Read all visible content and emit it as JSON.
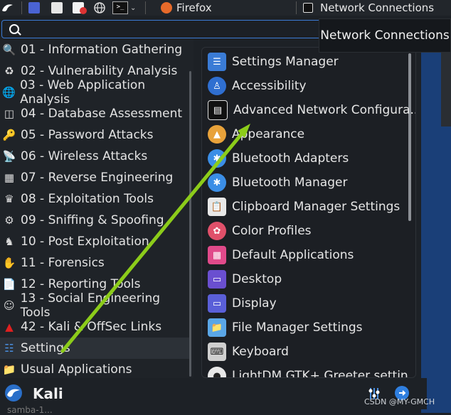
{
  "taskbar": {
    "tasks": [
      {
        "label": "Firefox",
        "icon": "firefox-icon"
      },
      {
        "label": "Network Connections",
        "icon": "network-icon"
      }
    ]
  },
  "search": {
    "placeholder": "",
    "value": ""
  },
  "tooltip": {
    "text": "Network Connections"
  },
  "categories": [
    {
      "label": "01 - Information Gathering",
      "icon": "magnifier-icon"
    },
    {
      "label": "02 - Vulnerability Analysis",
      "icon": "vulnerability-icon"
    },
    {
      "label": "03 - Web Application Analysis",
      "icon": "globe-icon"
    },
    {
      "label": "04 - Database Assessment",
      "icon": "database-icon"
    },
    {
      "label": "05 - Password Attacks",
      "icon": "key-icon"
    },
    {
      "label": "06 - Wireless Attacks",
      "icon": "wireless-icon"
    },
    {
      "label": "07 - Reverse Engineering",
      "icon": "chip-icon"
    },
    {
      "label": "08 - Exploitation Tools",
      "icon": "crown-icon"
    },
    {
      "label": "09 - Sniffing & Spoofing",
      "icon": "sniff-icon"
    },
    {
      "label": "10 - Post Exploitation",
      "icon": "post-exploit-icon"
    },
    {
      "label": "11 - Forensics",
      "icon": "hand-icon"
    },
    {
      "label": "12 - Reporting Tools",
      "icon": "report-icon"
    },
    {
      "label": "13 - Social Engineering Tools",
      "icon": "social-icon"
    },
    {
      "label": "42 - Kali & OffSec Links",
      "icon": "kali-flag-icon"
    },
    {
      "label": "Settings",
      "icon": "settings-icon"
    },
    {
      "label": "Usual Applications",
      "icon": "folder-icon"
    }
  ],
  "submenu": [
    {
      "label": "Settings Manager",
      "icon": "sliders-icon",
      "color": "#3a7bd5"
    },
    {
      "label": "Accessibility",
      "icon": "accessibility-icon",
      "color": "#2f6fd1"
    },
    {
      "label": "Advanced Network Configura...",
      "icon": "network-config-icon",
      "color": "#111111"
    },
    {
      "label": "Appearance",
      "icon": "appearance-icon",
      "color": "#e8a23a"
    },
    {
      "label": "Bluetooth Adapters",
      "icon": "bluetooth-icon",
      "color": "#3b8ee6"
    },
    {
      "label": "Bluetooth Manager",
      "icon": "bluetooth-icon",
      "color": "#3b8ee6"
    },
    {
      "label": "Clipboard Manager Settings",
      "icon": "clipboard-icon",
      "color": "#e8e8e8"
    },
    {
      "label": "Color Profiles",
      "icon": "color-profiles-icon",
      "color": "#e0506a"
    },
    {
      "label": "Default Applications",
      "icon": "default-apps-icon",
      "color": "#e04a8a"
    },
    {
      "label": "Desktop",
      "icon": "desktop-icon",
      "color": "#6a4fd0"
    },
    {
      "label": "Display",
      "icon": "display-icon",
      "color": "#5a5fd8"
    },
    {
      "label": "File Manager Settings",
      "icon": "file-manager-icon",
      "color": "#5aa6e6"
    },
    {
      "label": "Keyboard",
      "icon": "keyboard-icon",
      "color": "#cfcfcf"
    },
    {
      "label": "LightDM GTK+ Greeter settin...",
      "icon": "lightdm-icon",
      "color": "#e8e8e8"
    }
  ],
  "bottom": {
    "label": "Kali"
  },
  "watermark": "CSDN @MY-GMCH",
  "peek": "samba-1...",
  "colors": {
    "accent": "#3b7bd6",
    "arrow": "#8ccc1a"
  }
}
